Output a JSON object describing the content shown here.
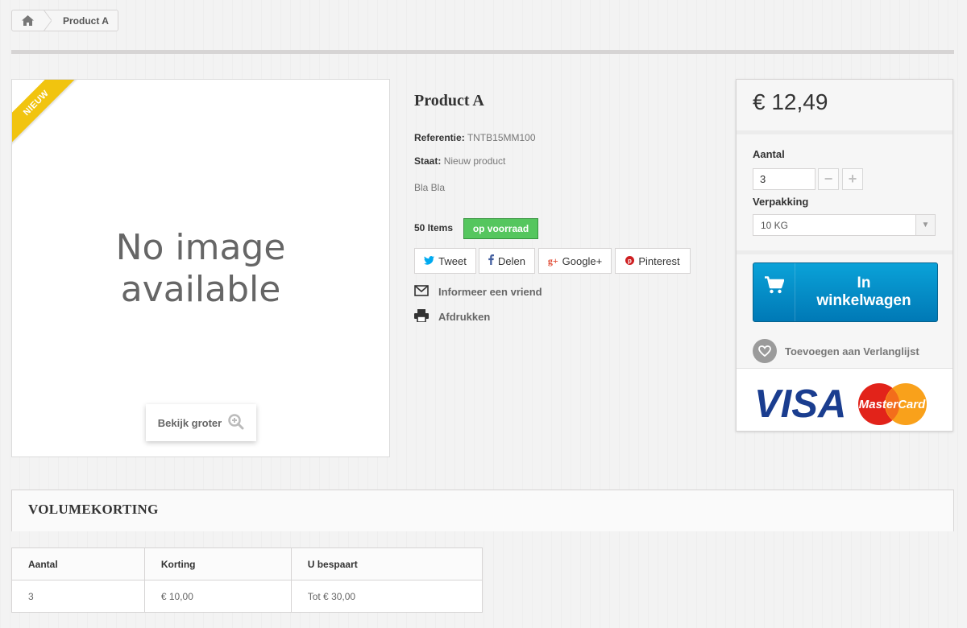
{
  "breadcrumb": {
    "home_icon": "home-icon",
    "current": "Product A"
  },
  "product": {
    "badge": "NIEUW",
    "no_image_line1": "No image",
    "no_image_line2": "available",
    "zoom_label": "Bekijk groter",
    "title": "Product A",
    "reference_label": "Referentie:",
    "reference_value": "TNTB15MM100",
    "condition_label": "Staat:",
    "condition_value": "Nieuw product",
    "description": "Bla Bla",
    "stock_count": "50 Items",
    "stock_status": "op voorraad",
    "stock_color": "#55c65e"
  },
  "share": {
    "tweet": "Tweet",
    "delen": "Delen",
    "google": "Google+",
    "pinterest": "Pinterest",
    "colors": {
      "twitter": "#00aaf0",
      "facebook": "#435f9f",
      "google": "#e04b34",
      "pinterest": "#ce1f21"
    }
  },
  "links": {
    "inform_friend": "Informeer een vriend",
    "print": "Afdrukken"
  },
  "buy_box": {
    "price": "€ 12,49",
    "quantity_label": "Aantal",
    "quantity_value": "3",
    "minus": "−",
    "plus": "+",
    "packaging_label": "Verpakking",
    "packaging_value": "10 KG",
    "cart_line1": "In",
    "cart_line2": "winkelwagen",
    "cart_color": "#0a9ad6",
    "wishlist": "Toevoegen aan Verlanglijst",
    "visa": "VISA",
    "mastercard": "MasterCard"
  },
  "volume": {
    "title": "VOLUMEKORTING",
    "headers": [
      "Aantal",
      "Korting",
      "U bespaart"
    ],
    "rows": [
      [
        "3",
        "€ 10,00",
        "Tot € 30,00"
      ]
    ]
  }
}
